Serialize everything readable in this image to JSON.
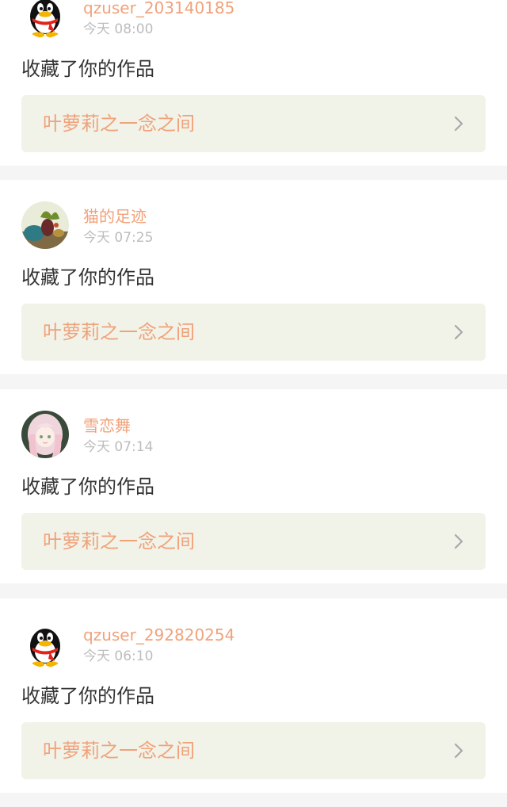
{
  "colors": {
    "username": "#f0a27a",
    "work_title": "#f0a27a",
    "time": "#bdbdbd",
    "work_bg": "#f1f3e9",
    "separator": "#f5f5f5"
  },
  "notifications": [
    {
      "avatar_icon": "qq-penguin-icon",
      "username": "qzuser_203140185",
      "time": "今天 08:00",
      "action": "收藏了你的作品",
      "work_title": "叶萝莉之一念之间"
    },
    {
      "avatar_icon": "still-life-photo-avatar",
      "username": "猫的足迹",
      "time": "今天 07:25",
      "action": "收藏了你的作品",
      "work_title": "叶萝莉之一念之间"
    },
    {
      "avatar_icon": "anime-girl-avatar",
      "username": "雪恋舞",
      "time": "今天 07:14",
      "action": "收藏了你的作品",
      "work_title": "叶萝莉之一念之间"
    },
    {
      "avatar_icon": "qq-penguin-icon",
      "username": "qzuser_292820254",
      "time": "今天 06:10",
      "action": "收藏了你的作品",
      "work_title": "叶萝莉之一念之间"
    }
  ]
}
